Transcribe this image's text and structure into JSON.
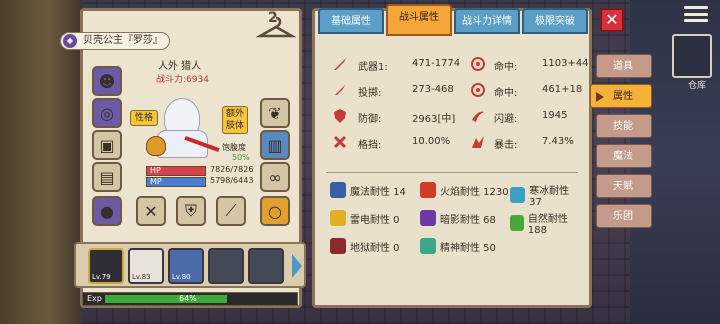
{
  "character": {
    "title_name": "贝壳公主『罗莎』",
    "race": "人外 猎人",
    "power_label": "战斗力:6934",
    "satiety_label": "饱腹度",
    "satiety_pct": "50%",
    "hp_label": "HP",
    "hp_value": "7826/7826",
    "mp_label": "MP",
    "mp_value": "5798/6443",
    "tag_personality": "性格",
    "tag_extra": "额外肢体",
    "outfit_count": "2"
  },
  "team": [
    {
      "level": "Lv.79"
    },
    {
      "level": "Lv.83"
    },
    {
      "level": "Lv.80"
    },
    {
      "level": ""
    },
    {
      "level": ""
    }
  ],
  "exp": {
    "label": "Exp",
    "percent_text": "64%",
    "fraction": 0.64
  },
  "tabs": [
    {
      "label": "基础属性",
      "active": false
    },
    {
      "label": "战斗属性",
      "active": true
    },
    {
      "label": "战斗力详情",
      "active": false
    },
    {
      "label": "极限突破",
      "active": false
    }
  ],
  "side_nav": [
    {
      "label": "道具",
      "active": false
    },
    {
      "label": "属性",
      "active": true
    },
    {
      "label": "技能",
      "active": false
    },
    {
      "label": "魔法",
      "active": false
    },
    {
      "label": "天赋",
      "active": false
    },
    {
      "label": "乐团",
      "active": false
    }
  ],
  "map_label": "仓库",
  "stats": [
    {
      "k1": "武器1:",
      "v1": "471-1774",
      "k2": "命中:",
      "v2": "1103+44"
    },
    {
      "k1": "投掷:",
      "v1": "273-468",
      "k2": "命中:",
      "v2": "461+18"
    },
    {
      "k1": "防御:",
      "v1": "2963[中]",
      "k2": "闪避:",
      "v2": "1945"
    },
    {
      "k1": "格挡:",
      "v1": "10.00%",
      "k2": "暴击:",
      "v2": "7.43%"
    }
  ],
  "resistances": [
    [
      {
        "label": "魔法耐性 14",
        "color": "#3b5ea8"
      },
      {
        "label": "火焰耐性 1230",
        "color": "#d23a2a"
      },
      {
        "label": "寒冰耐性 37",
        "color": "#3aa0c8"
      }
    ],
    [
      {
        "label": "雷电耐性 0",
        "color": "#e0b020"
      },
      {
        "label": "暗影耐性 68",
        "color": "#6a3aa8"
      },
      {
        "label": "自然耐性 188",
        "color": "#4aa83a"
      }
    ],
    [
      {
        "label": "地狱耐性 0",
        "color": "#8a2a2a"
      },
      {
        "label": "精神耐性 50",
        "color": "#3aa888"
      }
    ]
  ],
  "colors": {
    "accent": "#f4a63a",
    "tab": "#5b9fc8",
    "close": "#d8303a"
  }
}
